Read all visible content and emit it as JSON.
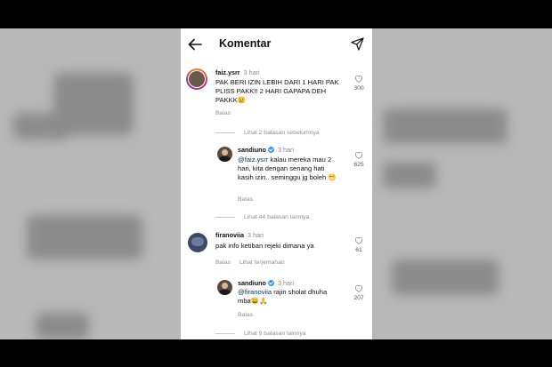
{
  "header": {
    "title": "Komentar"
  },
  "comments": [
    {
      "username": "faiz.ysrr",
      "time": "3 hari",
      "text": "PAK BERI IZIN LEBIH DARI 1 HARI PAK PLISS PAKK!! 2 HARI GAPAPA DEH PAKKK😢",
      "likes": "300",
      "reply": "Balas"
    },
    {
      "username": "sandiuno",
      "time": "3 hari",
      "mention": "@faiz.ysrr",
      "text": " kalau mereka mau 2 hari, kita dengan senang hati kasih izin.. seminggu jg boleh 😁",
      "likes": "625",
      "reply": "Balas"
    },
    {
      "username": "firanoviia",
      "time": "3 hari",
      "text": "pak info ketiban rejeki dimana ya",
      "likes": "61",
      "reply": "Balas",
      "translate": "Lihat terjemahan"
    },
    {
      "username": "sandiuno",
      "time": "3 hari",
      "mention": "@firanoviia",
      "text": " rajin sholat dhuha mba😀🙏",
      "likes": "207",
      "reply": "Balas"
    }
  ],
  "view_more": {
    "previous": "Lihat 2 balasan sebelumnya",
    "more_44": "Lihat 44 balasan lainnya",
    "more_9": "Lihat 9 balasan lainnya"
  },
  "colors": {
    "verified": "#3897f0",
    "mention": "#00376b",
    "muted": "#8e8e8e"
  }
}
